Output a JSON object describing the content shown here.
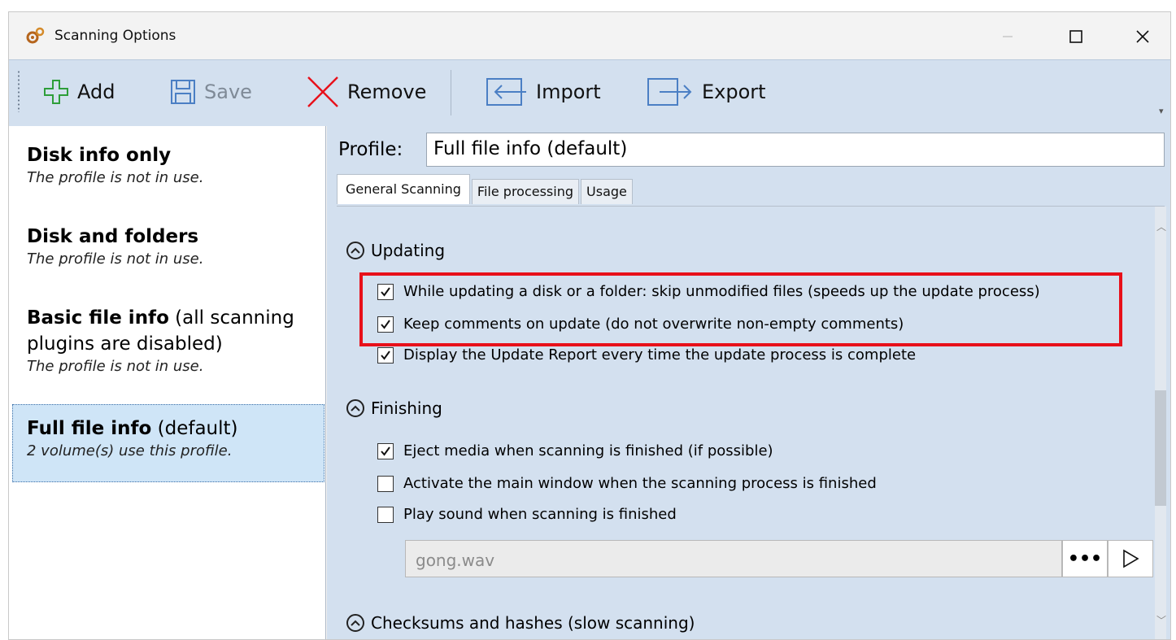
{
  "window": {
    "title": "Scanning Options",
    "icon": "settings-gears-icon",
    "controls": {
      "minimize": "—",
      "maximize": "☐",
      "close": "✕"
    }
  },
  "toolbar": {
    "add_label": "Add",
    "save_label": "Save",
    "remove_label": "Remove",
    "import_label": "Import",
    "export_label": "Export",
    "overflow": "▾"
  },
  "profiles": [
    {
      "name": "Disk info only",
      "suffix": "",
      "status": "The profile is not in use."
    },
    {
      "name": "Disk and folders",
      "suffix": "",
      "status": "The profile is not in use."
    },
    {
      "name": "Basic file info",
      "suffix": " (all scanning plugins are disabled)",
      "status": "The profile is not in use."
    },
    {
      "name": "Full file info",
      "suffix": " (default)",
      "status": "2 volume(s) use this profile.",
      "selected": true
    }
  ],
  "editor": {
    "profile_label": "Profile:",
    "profile_value": "Full file info (default)",
    "tabs": [
      "General Scanning",
      "File processing",
      "Usage"
    ],
    "active_tab": "General Scanning"
  },
  "sections": {
    "updating": {
      "title": "Updating",
      "options": [
        {
          "label": "While updating a disk or a folder: skip unmodified files (speeds up the update process)",
          "checked": true
        },
        {
          "label": "Keep comments on update (do not overwrite non-empty comments)",
          "checked": true
        },
        {
          "label": "Display the Update Report every time the update process is complete",
          "checked": true
        }
      ]
    },
    "finishing": {
      "title": "Finishing",
      "options": [
        {
          "label": "Eject media when scanning is finished (if possible)",
          "checked": true
        },
        {
          "label": "Activate the main window when the scanning process is finished",
          "checked": false
        },
        {
          "label": "Play sound when scanning is finished",
          "checked": false
        }
      ],
      "sound_file": "gong.wav",
      "browse_label": "•••"
    },
    "checksums": {
      "title": "Checksums and hashes (slow scanning)"
    }
  },
  "colors": {
    "highlight": "#e8101a",
    "pane_bg": "#d3e0ef",
    "selected_bg": "#cfe5f7"
  }
}
